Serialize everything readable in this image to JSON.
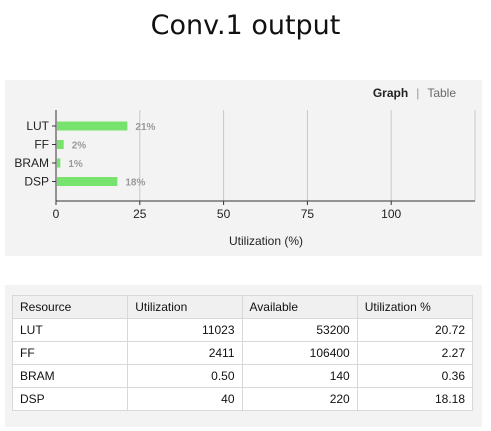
{
  "title": "Conv.1 output",
  "tabs": {
    "graph": "Graph",
    "separator": "|",
    "table": "Table"
  },
  "chart_data": {
    "type": "bar",
    "orientation": "horizontal",
    "categories": [
      "LUT",
      "FF",
      "BRAM",
      "DSP"
    ],
    "values": [
      21,
      2,
      1,
      18
    ],
    "value_labels": [
      "21%",
      "2%",
      "1%",
      "18%"
    ],
    "xlabel": "Utilization (%)",
    "ylabel": "",
    "xlim": [
      0,
      125
    ],
    "xticks": [
      0,
      25,
      50,
      75,
      100
    ],
    "grid": true,
    "bar_color": "#77e36d"
  },
  "table": {
    "headers": [
      "Resource",
      "Utilization",
      "Available",
      "Utilization %"
    ],
    "rows": [
      [
        "LUT",
        "11023",
        "53200",
        "20.72"
      ],
      [
        "FF",
        "2411",
        "106400",
        "2.27"
      ],
      [
        "BRAM",
        "0.50",
        "140",
        "0.36"
      ],
      [
        "DSP",
        "40",
        "220",
        "18.18"
      ]
    ]
  }
}
